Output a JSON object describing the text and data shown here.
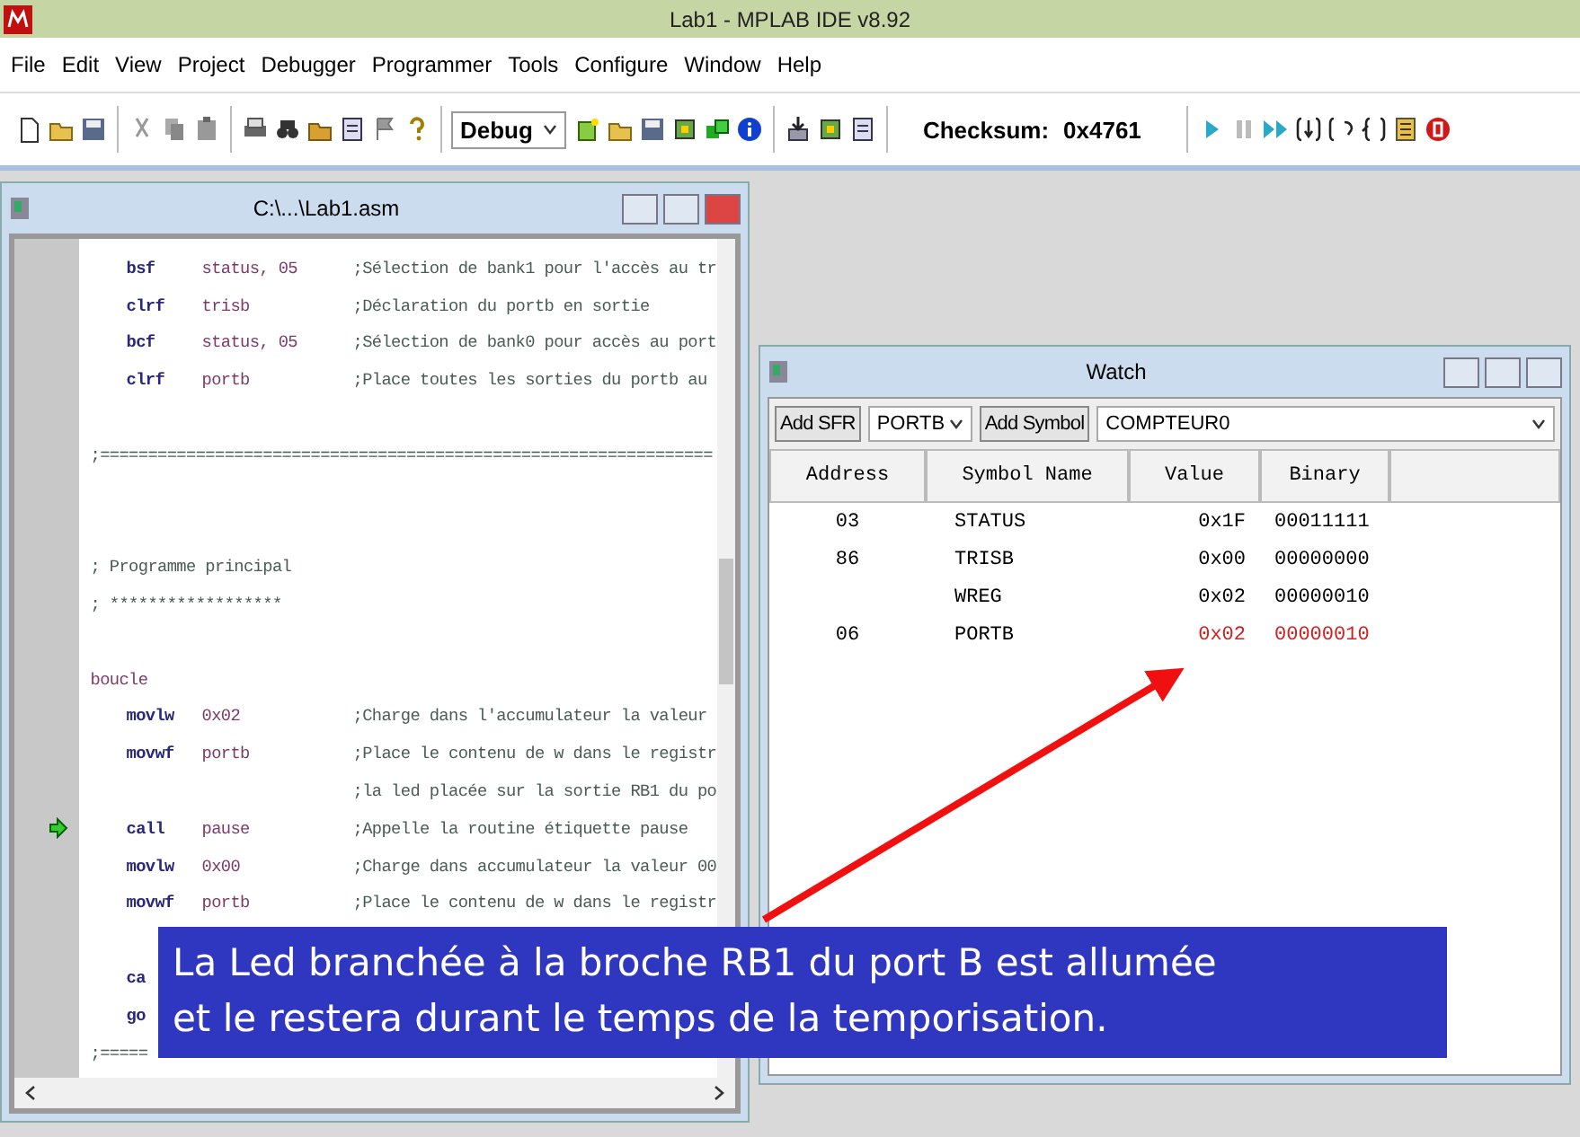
{
  "window": {
    "title": "Lab1 - MPLAB IDE v8.92"
  },
  "menu": [
    "File",
    "Edit",
    "View",
    "Project",
    "Debugger",
    "Programmer",
    "Tools",
    "Configure",
    "Window",
    "Help"
  ],
  "toolbar": {
    "build_config": "Debug",
    "checksum_label": "Checksum:",
    "checksum_value": "0x4761"
  },
  "editor": {
    "title": "C:\\...\\Lab1.asm",
    "lines": [
      {
        "kind": "instr",
        "mnemonic": "bsf",
        "operand": "status, 05",
        "comment": ";Sélection de bank1 pour l'accès au tr",
        "current": false
      },
      {
        "kind": "instr",
        "mnemonic": "clrf",
        "operand": "trisb",
        "comment": ";Déclaration du portb en sortie",
        "current": false
      },
      {
        "kind": "instr",
        "mnemonic": "bcf",
        "operand": "status, 05",
        "comment": ";Sélection de bank0 pour accès au port",
        "current": false
      },
      {
        "kind": "instr",
        "mnemonic": "clrf",
        "operand": "portb",
        "comment": ";Place toutes les sorties du portb au",
        "current": false
      },
      {
        "kind": "blank"
      },
      {
        "kind": "comment",
        "text": ";================================================================"
      },
      {
        "kind": "blank"
      },
      {
        "kind": "blank"
      },
      {
        "kind": "comment",
        "text": "; Programme principal"
      },
      {
        "kind": "comment",
        "text": "; ******************"
      },
      {
        "kind": "blank"
      },
      {
        "kind": "label",
        "text": "boucle"
      },
      {
        "kind": "instr",
        "mnemonic": "movlw",
        "operand": "0x02",
        "comment": ";Charge dans l'accumulateur la valeur",
        "current": false
      },
      {
        "kind": "instr",
        "mnemonic": "movwf",
        "operand": "portb",
        "comment": ";Place le contenu de w dans le registr",
        "current": false
      },
      {
        "kind": "instr",
        "comment": ";la led placée sur la sortie RB1 du po",
        "current": false
      },
      {
        "kind": "instr",
        "mnemonic": "call",
        "operand": "pause",
        "comment": ";Appelle la routine étiquette pause",
        "current": true
      },
      {
        "kind": "instr",
        "mnemonic": "movlw",
        "operand": "0x00",
        "comment": ";Charge dans accumulateur la valeur 00",
        "current": false
      },
      {
        "kind": "instr",
        "mnemonic": "movwf",
        "operand": "portb",
        "comment": ";Place le contenu de w dans le registr",
        "current": false
      },
      {
        "kind": "blank"
      },
      {
        "kind": "instr",
        "mnemonic": "ca",
        "current": false
      },
      {
        "kind": "instr",
        "mnemonic": "go",
        "current": false
      },
      {
        "kind": "comment",
        "text": ";====="
      }
    ]
  },
  "watch": {
    "title": "Watch",
    "add_sfr": "Add SFR",
    "sfr_value": "PORTB",
    "add_symbol": "Add Symbol",
    "symbol_value": "COMPTEUR0",
    "columns": [
      "Address",
      "Symbol Name",
      "Value",
      "Binary"
    ],
    "rows": [
      {
        "address": "03",
        "symbol": "STATUS",
        "value": "0x1F",
        "binary": "00011111",
        "changed": false
      },
      {
        "address": "86",
        "symbol": "TRISB",
        "value": "0x00",
        "binary": "00000000",
        "changed": false
      },
      {
        "symbol": "WREG",
        "value": "0x02",
        "binary": "00000010",
        "changed": false
      },
      {
        "address": "06",
        "symbol": "PORTB",
        "value": "0x02",
        "binary": "00000010",
        "changed": true
      }
    ]
  },
  "callout": {
    "text": "La Led branchée à la broche RB1 du port B est allumée\net le restera durant le temps de la temporisation."
  }
}
